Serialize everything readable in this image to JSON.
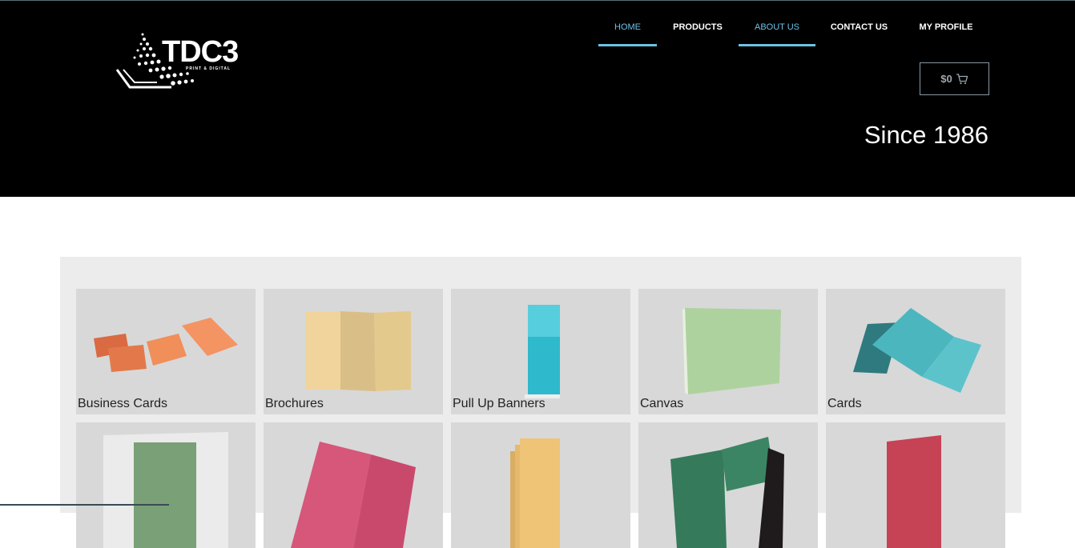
{
  "logo": {
    "text": "TDC3",
    "subtext": "PRINT & DIGITAL"
  },
  "nav": {
    "items": [
      {
        "label": "HOME",
        "active": true
      },
      {
        "label": "PRODUCTS",
        "active": false
      },
      {
        "label": "ABOUT US",
        "active": true
      },
      {
        "label": "CONTACT US",
        "active": false
      },
      {
        "label": "MY PROFILE",
        "active": false
      }
    ]
  },
  "cart": {
    "amount": "$0",
    "icon": "cart-icon"
  },
  "hero": {
    "tagline": "Since 1986"
  },
  "products": {
    "tiles": [
      {
        "label": "Business Cards",
        "color": "#f08f5a"
      },
      {
        "label": "Brochures",
        "color": "#ecd39a"
      },
      {
        "label": "Pull Up Banners",
        "color": "#2fb9cc"
      },
      {
        "label": "Canvas",
        "color": "#aed29e"
      },
      {
        "label": "Cards",
        "color": "#4cb6bf"
      },
      {
        "label": "",
        "color": "#7aa077"
      },
      {
        "label": "",
        "color": "#d6577a"
      },
      {
        "label": "",
        "color": "#efc477"
      },
      {
        "label": "",
        "color": "#357a5b"
      },
      {
        "label": "",
        "color": "#c64255"
      }
    ]
  },
  "colors": {
    "accent": "#6ec1e4",
    "header_bg": "#000000",
    "grid_bg": "#ececec"
  }
}
